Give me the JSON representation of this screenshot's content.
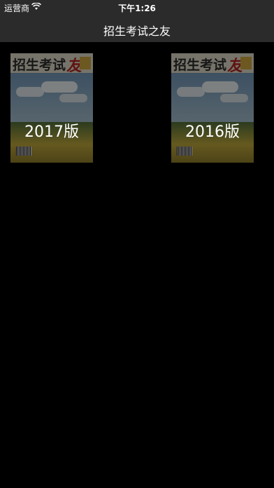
{
  "status_bar": {
    "carrier": "运营商",
    "time": "下午1:26",
    "wifi_icon": "wifi-icon"
  },
  "nav": {
    "title": "招生考试之友"
  },
  "magazines": [
    {
      "label": "2017版",
      "cover_title": "招生考试",
      "cover_title_accent": "友"
    },
    {
      "label": "2016版",
      "cover_title": "招生考试",
      "cover_title_accent": "友"
    }
  ],
  "colors": {
    "bar_background": "#2b2b2b",
    "page_background": "#000000",
    "text": "#ffffff",
    "cover_accent_red": "#b0231e"
  }
}
